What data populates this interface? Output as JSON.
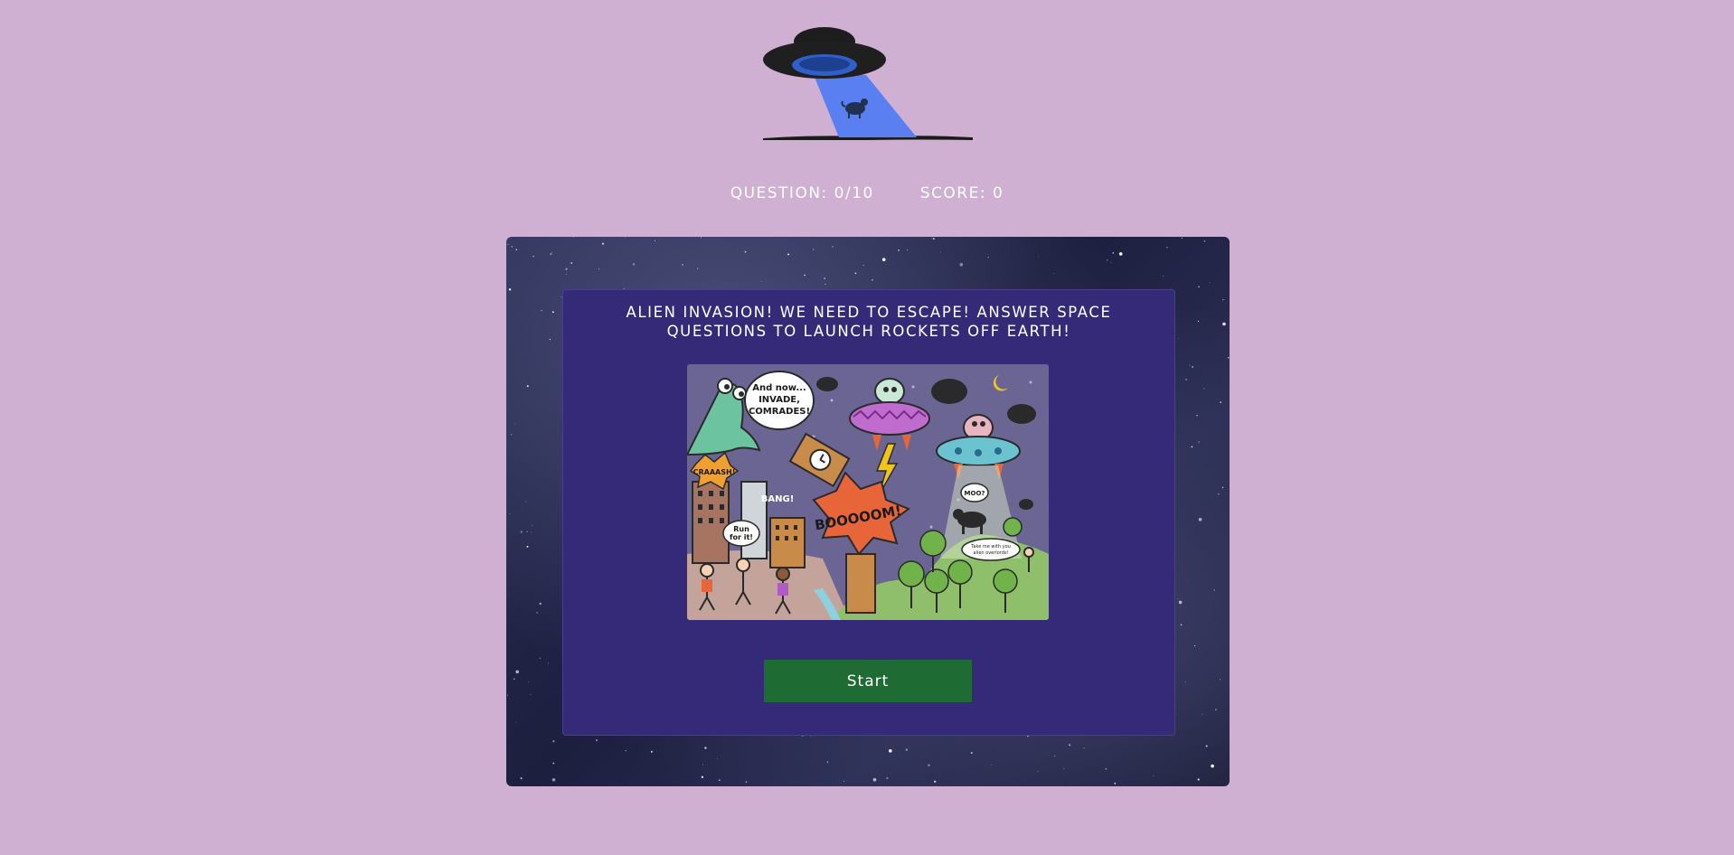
{
  "stats": {
    "question_label": "QUESTION: 0/10",
    "score_label": "SCORE: 0"
  },
  "intro": {
    "title": "ALIEN INVASION! WE NEED TO ESCAPE! ANSWER SPACE QUESTIONS TO LAUNCH ROCKETS OFF EARTH!"
  },
  "illustration": {
    "bubble_invade": "And now... INVADE, COMRADES!",
    "bubble_crash": "CRAAASH!",
    "bubble_bang": "BANG!",
    "bubble_run": "Run for it!",
    "bubble_boom": "BOOOOOM!",
    "bubble_moo": "MOO?",
    "bubble_take": "Take me with you alien overlords!"
  },
  "actions": {
    "start_label": "Start"
  },
  "colors": {
    "background": "#cfb0d2",
    "card": "#352a78",
    "start_button": "#1f6b34",
    "ufo_beam": "#5a7ff0"
  }
}
